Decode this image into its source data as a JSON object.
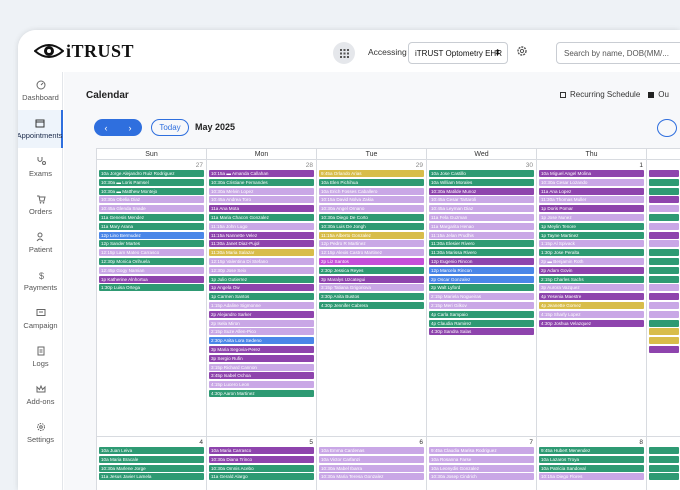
{
  "topbar": {
    "logo_text": "iTRUST",
    "accessing_label": "Accessing",
    "practice_value": "iTRUST Optometry EHR",
    "search_placeholder": "Search by name, DOB(MM/..."
  },
  "sidebar": {
    "items": [
      {
        "label": "Dashboard",
        "icon": "dashboard-icon"
      },
      {
        "label": "Appointments",
        "icon": "calendar-icon",
        "active": true
      },
      {
        "label": "Exams",
        "icon": "stethoscope-icon"
      },
      {
        "label": "Orders",
        "icon": "cart-icon"
      },
      {
        "label": "Patient",
        "icon": "patient-icon"
      },
      {
        "label": "Payments",
        "icon": "dollar-icon"
      },
      {
        "label": "Campaign",
        "icon": "message-icon"
      },
      {
        "label": "Logs",
        "icon": "document-icon"
      },
      {
        "label": "Add-ons",
        "icon": "crown-icon"
      },
      {
        "label": "Settings",
        "icon": "gear-icon"
      }
    ]
  },
  "calendar": {
    "title": "Calendar",
    "recurring_label": "Recurring Schedule",
    "other_label": "Ou",
    "today_label": "Today",
    "month_label": "May 2025",
    "prev_symbol": "‹",
    "next_symbol": "›",
    "day_headers": [
      "Sun",
      "Mon",
      "Tue",
      "Wed",
      "Thu"
    ],
    "week1_dates": [
      "27",
      "28",
      "29",
      "30",
      "1"
    ],
    "week2_dates": [
      "4",
      "5",
      "6",
      "7",
      "8"
    ],
    "week1": [
      [
        {
          "t": "10a Jorge Alejandro Ruiz Rodriguez",
          "c": "green"
        },
        {
          "t": "10:30a ▬ Loris Pamsel",
          "c": "green"
        },
        {
          "t": "10:30a ▬ Matthew Montejo",
          "c": "green"
        },
        {
          "t": "10:30a Obelia Diaz",
          "c": "lav"
        },
        {
          "t": "10:45a Glenda Snade",
          "c": "lav"
        },
        {
          "t": "11a Genesis Mendez",
          "c": "green"
        },
        {
          "t": "11a Mary Arana",
          "c": "green"
        },
        {
          "t": "12p Lino Bermudez",
          "c": "blue"
        },
        {
          "t": "12p Sander Martes",
          "c": "green"
        },
        {
          "t": "12:15p Lam Mateo Carrasco",
          "c": "lav"
        },
        {
          "t": "12:30p Monica Orihuela",
          "c": "green"
        },
        {
          "t": "12:45p Gogy Namian",
          "c": "lav"
        },
        {
          "t": "1p Katherine Alnhortua",
          "c": "purple"
        },
        {
          "t": "1:30p Luisa Ortega",
          "c": "green"
        }
      ],
      [
        {
          "t": "10:15a ▬ Amanda Callahan",
          "c": "purple"
        },
        {
          "t": "10:30a Cristiane Fernandes",
          "c": "green"
        },
        {
          "t": "10:30a Melvin Lopez",
          "c": "lav"
        },
        {
          "t": "10:45a Andrea Toro",
          "c": "lav"
        },
        {
          "t": "11a Ana Mota",
          "c": "purple"
        },
        {
          "t": "11a Maria Chacon Gonzalez",
          "c": "green"
        },
        {
          "t": "11:15a John Lugo",
          "c": "lav"
        },
        {
          "t": "11:15a Nannette Velez",
          "c": "purple"
        },
        {
          "t": "11:30a Janet Diaz-Pujol",
          "c": "purple"
        },
        {
          "t": "11:30a Maria Salazar",
          "c": "yellow"
        },
        {
          "t": "12:15p Valentina Di Stefano",
          "c": "lav"
        },
        {
          "t": "12:30p Jose Seix",
          "c": "lav"
        },
        {
          "t": "1p Julio Gutierrez",
          "c": "green"
        },
        {
          "t": "1p Angela Ow",
          "c": "purple"
        },
        {
          "t": "1p Carmen Santos",
          "c": "green"
        },
        {
          "t": "1:15p Adaline Sigmonne",
          "c": "lav"
        },
        {
          "t": "2p Alejandro Sarker",
          "c": "purple"
        },
        {
          "t": "2p Isela Miron",
          "c": "lav"
        },
        {
          "t": "2:15p Suze Allen-Pico",
          "c": "lav"
        },
        {
          "t": "2:30p Anita Lora Sedeno",
          "c": "blue"
        },
        {
          "t": "3p Maria Segovia-Perez",
          "c": "purple"
        },
        {
          "t": "3p Sergio Rufin",
          "c": "purple"
        },
        {
          "t": "3:15p Richard Cannon",
          "c": "lav"
        },
        {
          "t": "3:45p Isabel Ochoa",
          "c": "purple"
        },
        {
          "t": "4:15p Lucero Leon",
          "c": "lav"
        },
        {
          "t": "4:30p Aaron Martinez",
          "c": "green"
        }
      ],
      [
        {
          "t": "9:45a Orlando Arias",
          "c": "yellow"
        },
        {
          "t": "10a Elen Pichihua",
          "c": "green"
        },
        {
          "t": "10a Erich Fosses Caballero",
          "c": "lav"
        },
        {
          "t": "10:15a David Nolva Zakia",
          "c": "lav"
        },
        {
          "t": "10:30a Angel Ornano",
          "c": "lav"
        },
        {
          "t": "10:30a Diego De Corto",
          "c": "green"
        },
        {
          "t": "10:30a Luis De Jongh",
          "c": "green"
        },
        {
          "t": "11:15a Alberto Gonzalez",
          "c": "yellow"
        },
        {
          "t": "12p Pedro R Martinez",
          "c": "lav"
        },
        {
          "t": "12:15p Alexis Castro Martinez",
          "c": "lav"
        },
        {
          "t": "2p Liz Santos",
          "c": "magenta"
        },
        {
          "t": "2:30p Jessica Reyes",
          "c": "green"
        },
        {
          "t": "3p Maralys Uzcategui",
          "c": "purple"
        },
        {
          "t": "3:15p Tatiana Grigoriova",
          "c": "lav"
        },
        {
          "t": "3:30p Anita Bustos",
          "c": "green"
        },
        {
          "t": "4:30p Jennifer Cabrera",
          "c": "green"
        }
      ],
      [
        {
          "t": "10a Jose Castillo",
          "c": "green"
        },
        {
          "t": "10a William Morales",
          "c": "green"
        },
        {
          "t": "10:30a Matilde Munoz",
          "c": "purple"
        },
        {
          "t": "10:45a Cesar Tartaroli",
          "c": "lav"
        },
        {
          "t": "10:45a Leyman Diaz",
          "c": "lav"
        },
        {
          "t": "11a Fela Guzman",
          "c": "lav"
        },
        {
          "t": "11a Margarita Henao",
          "c": "lav"
        },
        {
          "t": "11:15a Jelan Prudhis",
          "c": "lav"
        },
        {
          "t": "11:30a Elesier Rivero",
          "c": "green"
        },
        {
          "t": "11:30a Marissa Rivero",
          "c": "green"
        },
        {
          "t": "12p Eugenio Rincon",
          "c": "purple"
        },
        {
          "t": "12p Marcela Rincon",
          "c": "blue"
        },
        {
          "t": "2p Oscar Gonzalez",
          "c": "blue"
        },
        {
          "t": "2p Walt Lyford",
          "c": "green"
        },
        {
          "t": "2:15p Mariela Nogueiras",
          "c": "lav"
        },
        {
          "t": "2:15p Meri Gilkov",
          "c": "lav"
        },
        {
          "t": "4p Carla Sampaio",
          "c": "green"
        },
        {
          "t": "4p Claudia Ramirez",
          "c": "green"
        },
        {
          "t": "4:30p Sandra Salas",
          "c": "purple"
        }
      ],
      [
        {
          "t": "10a Miguel Angel Molina",
          "c": "purple"
        },
        {
          "t": "10:30a Cesar Lozando",
          "c": "lav"
        },
        {
          "t": "11a Ana Lopez",
          "c": "purple"
        },
        {
          "t": "11:30a Thomas Muller",
          "c": "lav"
        },
        {
          "t": "1p Doris Pomar",
          "c": "purple"
        },
        {
          "t": "1p Jose Nunez",
          "c": "lav"
        },
        {
          "t": "1p Meylin Tenore",
          "c": "green"
        },
        {
          "t": "1p Tayne Martinez",
          "c": "green"
        },
        {
          "t": "1:15p Al Spivack",
          "c": "lav"
        },
        {
          "t": "1:30p Jose Peralta",
          "c": "green"
        },
        {
          "t": "2p ▬ Benjamin Roth",
          "c": "lav"
        },
        {
          "t": "2p Adam Govin",
          "c": "purple"
        },
        {
          "t": "2:15p Charles Sachs",
          "c": "green"
        },
        {
          "t": "3p Aurora Vazquez",
          "c": "lav"
        },
        {
          "t": "4p Yesenia Maestre",
          "c": "purple"
        },
        {
          "t": "4p Jeanette Gomez",
          "c": "yellow"
        },
        {
          "t": "4:15p Sharly Lopez",
          "c": "lav"
        },
        {
          "t": "4:30p Joshua Velazquez",
          "c": "purple"
        }
      ]
    ],
    "week2": [
      [
        {
          "t": "10a Juan Leiva",
          "c": "green"
        },
        {
          "t": "10a Maria Bracale",
          "c": "green"
        },
        {
          "t": "10:30a Marlene Jorge",
          "c": "green"
        },
        {
          "t": "11a Jesus Javier Lamela",
          "c": "green"
        }
      ],
      [
        {
          "t": "10a Maria Carrasco",
          "c": "purple"
        },
        {
          "t": "10:30a Diana Trinco",
          "c": "purple"
        },
        {
          "t": "10:30a Omnis Acebo",
          "c": "green"
        },
        {
          "t": "11a Gerald Alargo",
          "c": "green"
        }
      ],
      [
        {
          "t": "10a Emma Cardenas",
          "c": "lav"
        },
        {
          "t": "10a Victor Carfanzi",
          "c": "lav"
        },
        {
          "t": "10:30a Mabel Ibarra",
          "c": "lav"
        },
        {
          "t": "10:30a Maria Teresa Gonzalez",
          "c": "lav"
        }
      ],
      [
        {
          "t": "9:45a Claudia Marisa Rodriguez",
          "c": "lav"
        },
        {
          "t": "10a Rosanna Farse",
          "c": "lav"
        },
        {
          "t": "10a Leonydis Gonzalez",
          "c": "lav"
        },
        {
          "t": "10:30a Josep Cindrich",
          "c": "lav"
        }
      ],
      [
        {
          "t": "9:45a Hubert Menendez",
          "c": "green"
        },
        {
          "t": "10a Lazaros Troya",
          "c": "green"
        },
        {
          "t": "10a Patricia Sandoval",
          "c": "green"
        },
        {
          "t": "10:15a Diego Flores",
          "c": "lav"
        }
      ]
    ],
    "partial_col_colors": [
      "purple",
      "green",
      "green",
      "purple",
      "lav",
      "green",
      "lav",
      "purple",
      "lav",
      "green",
      "green",
      "green",
      "green",
      "lav",
      "purple",
      "lav",
      "lav",
      "green",
      "yellow",
      "yellow",
      "purple"
    ]
  }
}
